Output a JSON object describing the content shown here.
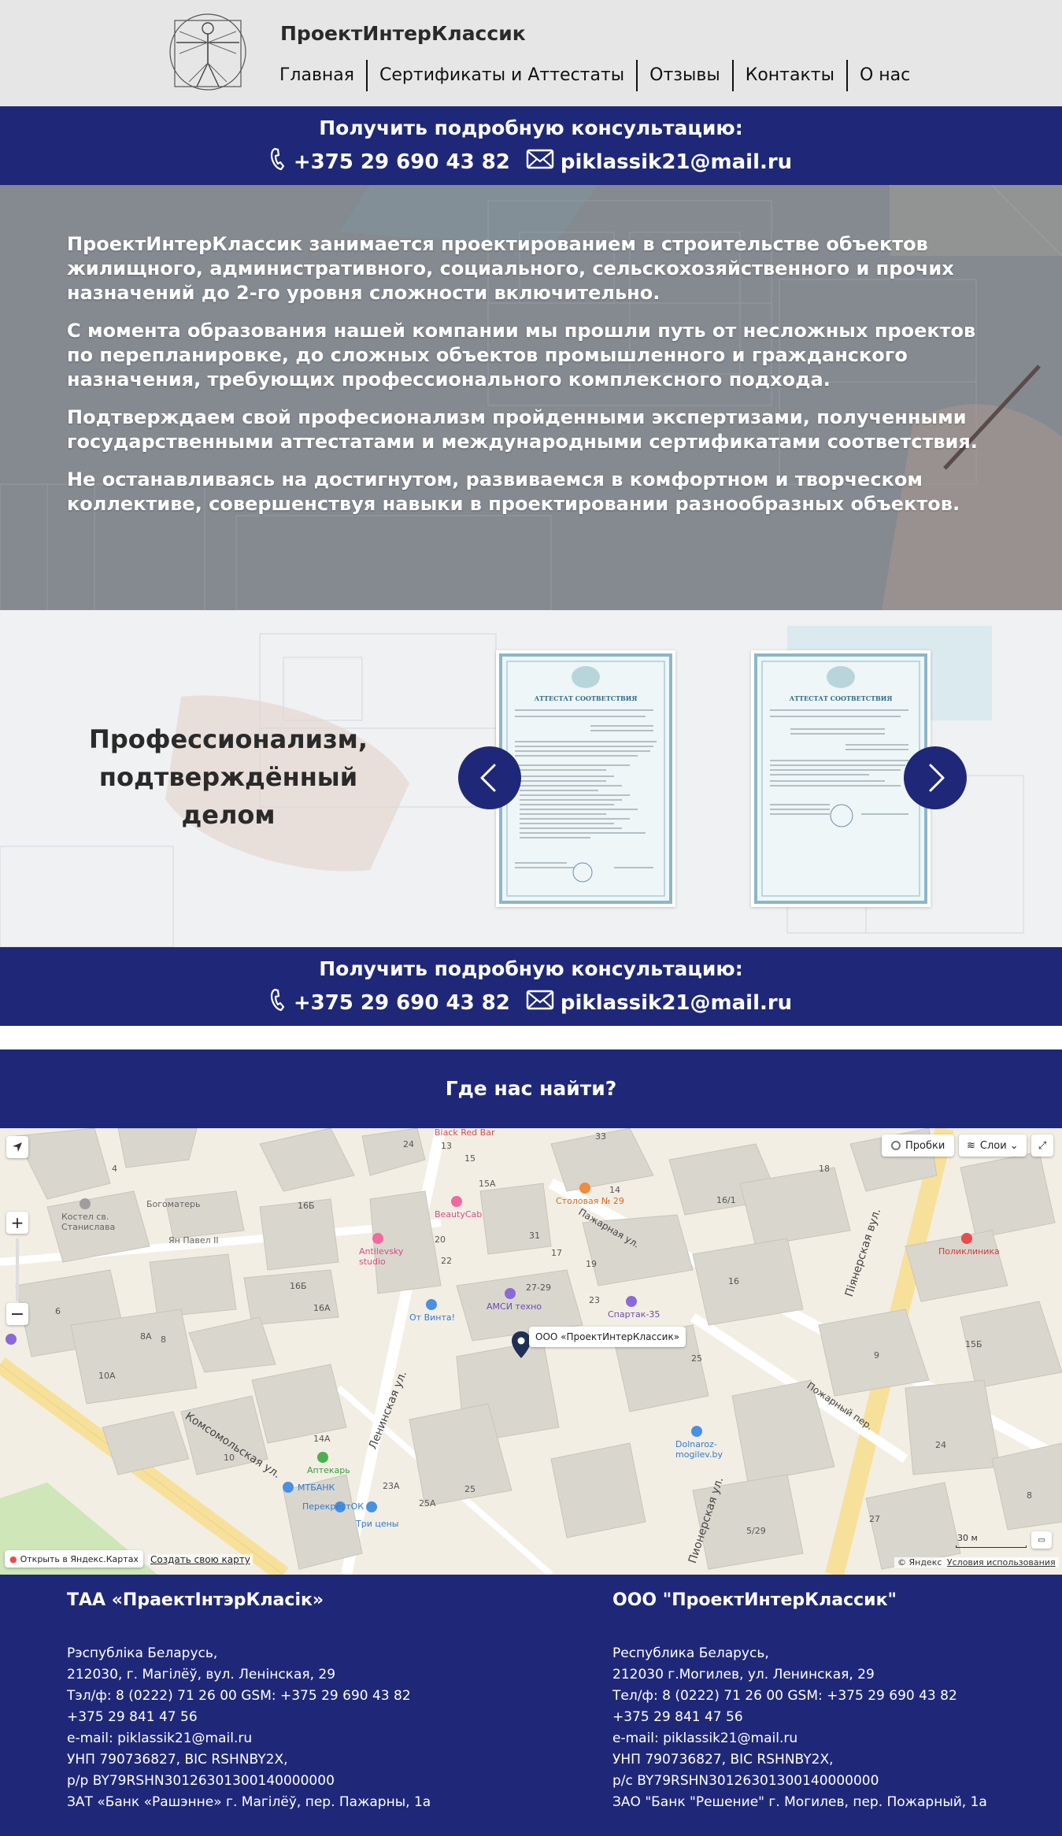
{
  "header": {
    "brand": "ПроектИнтерКлассик",
    "nav": [
      "Главная",
      "Сертификаты и Аттестаты",
      "Отзывы",
      "Контакты",
      "О нас"
    ]
  },
  "consult": {
    "title": "Получить подробную консультацию:",
    "phone": "+375 29 690 43 82",
    "email": "piklassik21@mail.ru"
  },
  "hero": {
    "paragraphs": [
      "ПроектИнтерКлассик занимается проектированием в строительстве объектов жилищного, административного, социального, сельскохозяйственного и прочих назначений до 2-го уровня сложности включительно.",
      "С момента образования нашей компании мы прошли путь от несложных проектов по перепланировке, до сложных объектов промышленного и гражданского назначения, требующих профессионального комплексного подхода.",
      "Подтверждаем свой професионализм пройденными экспертизами, полученными государственными аттестатами и международными сертификатами соответствия.",
      "Не останавливаясь на достигнутом, развиваемся в комфортном и творческом коллективе, совершенствуя навыки в проектировании разнообразных объектов."
    ]
  },
  "certs": {
    "title": "Профессионализм, подтверждённый делом",
    "cert_1_heading": "АТТЕСТАТ СООТВЕТСТВИЯ",
    "cert_2_heading": "АТТЕСТАТ СООТВЕТСТВИЯ"
  },
  "where": {
    "title": "Где нас найти?"
  },
  "map": {
    "traffic": "Пробки",
    "layers": "Слои",
    "marker_label": "ООО «ПроектИнтерКлассик»",
    "open_in_yandex": "Открыть в Яндекс.Картах",
    "create_map": "Создать свою карту",
    "copyright": "© Яндекс",
    "terms": "Условия использования",
    "scale": "30 м",
    "streets": [
      "Комсомольская ул.",
      "Ленинская ул.",
      "Пионерская ул.",
      "Пажарная ул.",
      "Пожарный пер.",
      "Пiянерская вул."
    ],
    "pois": [
      "Столовая № 29",
      "BeautyCab",
      "Antilevsky studio",
      "От Винта!",
      "АМСИ техно",
      "Спартак-35",
      "Dolnaroz-mogilev.by",
      "Аптекарь",
      "МТБАНК",
      "ПерекрёстОК",
      "Три цены",
      "Поликлиника",
      "Костел св. Станислава",
      "Богоматерь",
      "Ян Павел II",
      "Black Red Bar"
    ],
    "houses": [
      "4",
      "24",
      "13",
      "15",
      "33",
      "18",
      "16Б",
      "14",
      "16/1",
      "20",
      "31",
      "17",
      "15А",
      "22",
      "19",
      "16Б",
      "16А",
      "27-29",
      "23",
      "16",
      "6",
      "8А",
      "8",
      "10А",
      "25",
      "9",
      "15Б",
      "14А",
      "10",
      "23А",
      "25",
      "25А",
      "5/29",
      "27",
      "24",
      "8"
    ]
  },
  "footer": {
    "col1": {
      "title": "ТАА «ПраектІнтэрКласік»",
      "lines": [
        "Рэспубліка Беларусь,",
        "212030, г. Магілёў, вул. Ленінская, 29",
        "Тэл/ф: 8 (0222) 71 26 00 GSM: +375 29 690 43 82",
        "+375 29 841 47 56",
        "e-mail: piklassik21@mail.ru",
        "УНП 790736827, BIC RSHNBY2X,",
        "р/р BY79RSHN30126301300140000000",
        "ЗАТ «Банк «Рашэнне» г. Магілёў, пер. Пажарны, 1а"
      ]
    },
    "col2": {
      "title": "ООО \"ПроектИнтерКлассик\"",
      "lines": [
        "Республика Беларусь,",
        "212030 г.Могилев, ул. Ленинская, 29",
        "Тел/ф: 8 (0222) 71 26 00 GSM: +375 29 690 43 82",
        "+375 29 841 47 56",
        "e-mail: piklassik21@mail.ru",
        "УНП 790736827, BIC RSHNBY2X,",
        "р/с BY79RSHN30126301300140000000",
        "ЗАО \"Банк \"Решение\" г. Могилев, пер. Пожарный, 1а"
      ]
    }
  }
}
